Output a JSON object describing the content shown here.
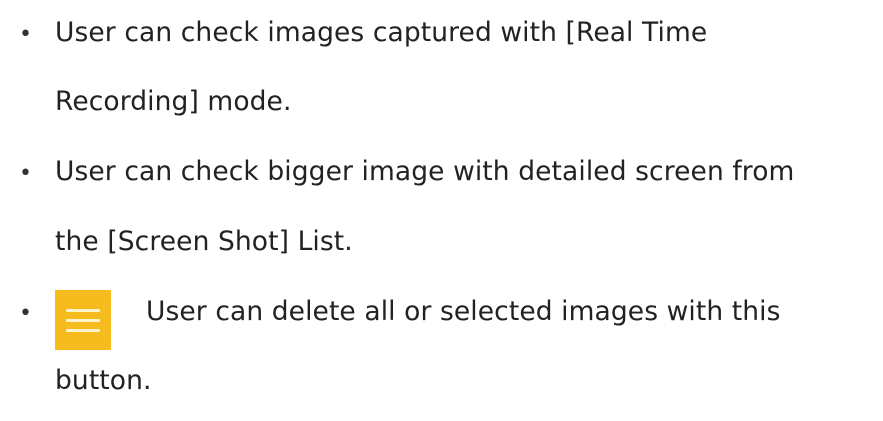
{
  "bullets": [
    {
      "lines": [
        "User can check images captured with [Real Time",
        "Recording] mode."
      ]
    },
    {
      "lines": [
        "User can check bigger image with detailed screen from",
        "the [Screen Shot] List."
      ]
    },
    {
      "icon": "menu-icon",
      "lines": [
        "User can delete all or selected images with this",
        "button."
      ]
    }
  ],
  "bullet_char": "•",
  "colors": {
    "menu_button": "#f6bb1c",
    "text": "#222222"
  }
}
